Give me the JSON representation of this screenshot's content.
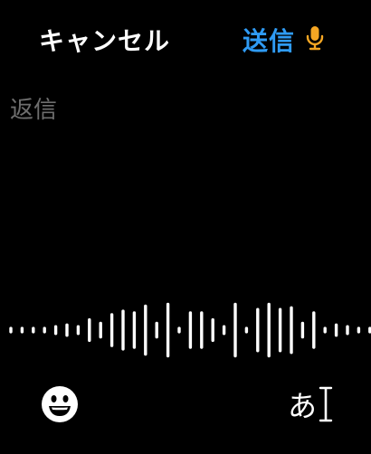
{
  "header": {
    "cancel_label": "キャンセル",
    "send_label": "送信",
    "send_color": "#2F9BF4",
    "mic_icon": "microphone-icon",
    "mic_color": "#F5A623"
  },
  "reply": {
    "placeholder": "返信",
    "placeholder_color": "#6E6E6E"
  },
  "footer": {
    "emoji_icon": "smiley-face-icon",
    "keyboard_label": "あ",
    "cursor_icon": "text-cursor-icon"
  },
  "waveform": {
    "icon": "voice-waveform",
    "levels": [
      0.05,
      0.05,
      0.05,
      0.05,
      0.1,
      0.15,
      0.1,
      0.3,
      0.2,
      0.45,
      0.55,
      0.5,
      0.7,
      0.2,
      0.75,
      0.05,
      0.5,
      0.5,
      0.3,
      0.1,
      0.75,
      0.05,
      0.6,
      0.75,
      0.6,
      0.65,
      0.2,
      0.5,
      0.05,
      0.15,
      0.1,
      0.05,
      0.05,
      0.05
    ]
  }
}
